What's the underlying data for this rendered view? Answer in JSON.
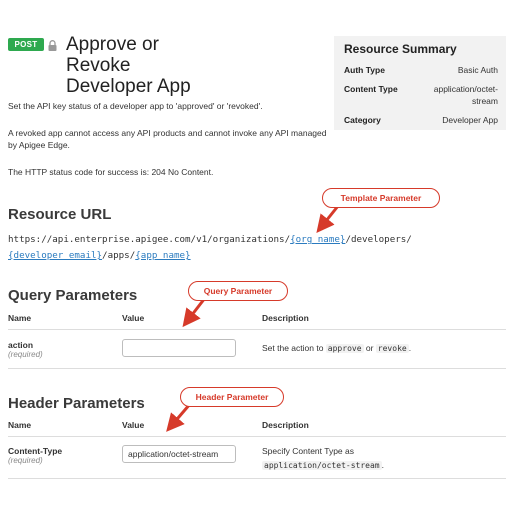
{
  "header": {
    "method": "POST",
    "title_line1": "Approve or",
    "title_line2": "Revoke",
    "title_line3": "Developer App"
  },
  "summary": {
    "title": "Resource Summary",
    "rows": [
      {
        "key": "Auth Type",
        "value": "Basic Auth"
      },
      {
        "key": "Content Type",
        "value": "application/octet-stream"
      },
      {
        "key": "Category",
        "value": "Developer App"
      }
    ]
  },
  "description": {
    "p1": "Set the API key status of a developer app to 'approved' or 'revoked'.",
    "p2": "A revoked app cannot access any API products and cannot invoke any API managed by Apigee Edge.",
    "p3": "The HTTP status code for success is: 204 No Content."
  },
  "resource_url": {
    "heading": "Resource URL",
    "part1": "https://api.enterprise.apigee.com/v1/organizations/",
    "org": "{org_name}",
    "part2": "/developers/",
    "email": "{developer_email}",
    "part3": "/apps/",
    "app": "{app_name}"
  },
  "query": {
    "heading": "Query Parameters",
    "col_name": "Name",
    "col_value": "Value",
    "col_desc": "Description",
    "param_name": "action",
    "param_req": "(required)",
    "value": "",
    "desc_pre": "Set the action to ",
    "desc_code1": "approve",
    "desc_mid": " or ",
    "desc_code2": "revoke",
    "desc_post": "."
  },
  "header_params": {
    "heading": "Header Parameters",
    "col_name": "Name",
    "col_value": "Value",
    "col_desc": "Description",
    "param_name": "Content-Type",
    "param_req": "(required)",
    "value": "application/octet-stream",
    "desc_line1": "Specify Content Type as",
    "desc_code": "application/octet-stream",
    "desc_post": "."
  },
  "callouts": {
    "template": "Template Parameter",
    "query": "Query Parameter",
    "header": "Header Parameter"
  },
  "colors": {
    "post_badge": "#2ea94f",
    "link": "#2b7bbf",
    "callout": "#d63a2a"
  },
  "icons": {
    "lock": "lock-icon",
    "arrow": "arrow-icon"
  }
}
